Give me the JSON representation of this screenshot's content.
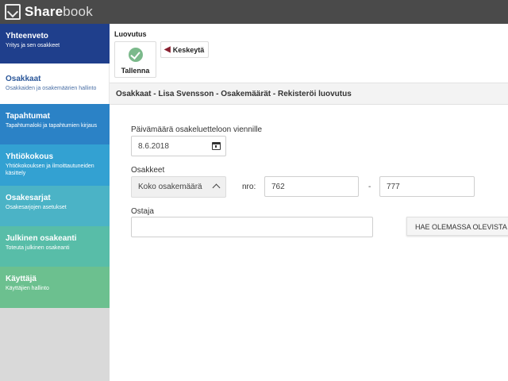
{
  "app": {
    "logo_bold": "Share",
    "logo_rest": "book"
  },
  "sidebar": {
    "items": [
      {
        "title": "Yhteenveto",
        "subtitle": "Yritys ja sen osakkeet"
      },
      {
        "title": "Osakkaat",
        "subtitle": "Osakkaiden ja osakemäärien hallinto"
      },
      {
        "title": "Tapahtumat",
        "subtitle": "Tapahtumaloki ja tapahtumien kirjaus"
      },
      {
        "title": "Yhtiökokous",
        "subtitle": "Yhtiökokouksen ja ilmoittautuneiden käsittely"
      },
      {
        "title": "Osakesarjat",
        "subtitle": "Osakesarjojen asetukset"
      },
      {
        "title": "Julkinen osakeanti",
        "subtitle": "Toteuta julkinen osakeanti"
      },
      {
        "title": "Käyttäjä",
        "subtitle": "Käyttäjien hallinto"
      }
    ]
  },
  "toolbar": {
    "section_label": "Luovutus",
    "save_label": "Tallenna",
    "cancel_label": "Keskeytä"
  },
  "breadcrumb": "Osakkaat - Lisa Svensson - Osakemäärät - Rekisteröi luovutus",
  "form": {
    "date_label": "Päivämäärä osakeluetteloon viennille",
    "date_value": "8.6.2018",
    "shares_label": "Osakkeet",
    "shares_select": "Koko osakemäärä",
    "nro_label": "nro:",
    "nro_from": "762",
    "range_dash": "-",
    "nro_to": "777",
    "buyer_label": "Ostaja",
    "buyer_value": "",
    "search_existing_button": "HAE OLEMASSA OLEVISTA"
  }
}
